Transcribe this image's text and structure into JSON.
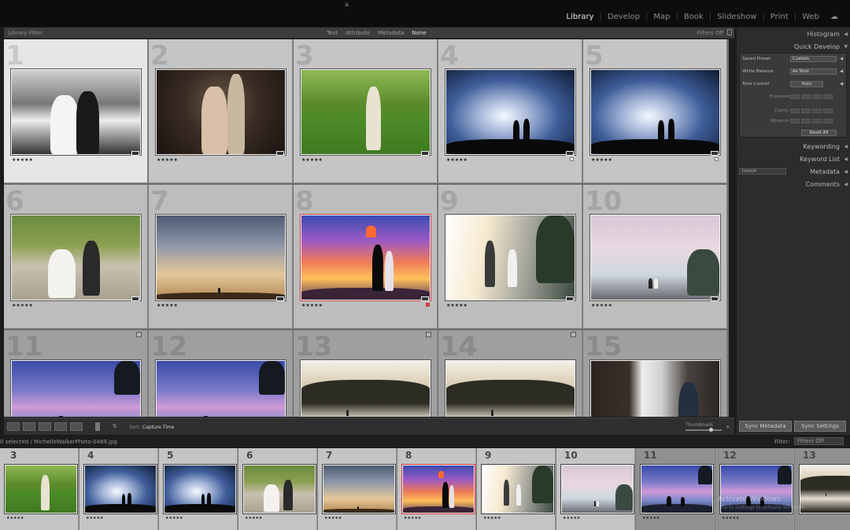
{
  "modules": [
    "Library",
    "Develop",
    "Map",
    "Book",
    "Slideshow",
    "Print",
    "Web"
  ],
  "active_module": "Library",
  "filter_bar": {
    "title": "Library Filter",
    "tabs": [
      "Text",
      "Attribute",
      "Metadata",
      "None"
    ],
    "active_tab": "None",
    "filters_status": "Filters Off"
  },
  "grid": {
    "cells": [
      {
        "num": "1",
        "img": "bride-car",
        "stars": "★★★★★",
        "selected": true
      },
      {
        "num": "2",
        "img": "couple-flowers",
        "stars": "★★★★★"
      },
      {
        "num": "3",
        "img": "bride-garden",
        "stars": "★★★★★"
      },
      {
        "num": "4",
        "img": "veil-clouds",
        "stars": "★★★★★"
      },
      {
        "num": "5",
        "img": "veil-clouds",
        "stars": "★★★★★"
      },
      {
        "num": "6",
        "img": "couple-bench",
        "stars": "★★★★★"
      },
      {
        "num": "7",
        "img": "sunset-sky",
        "stars": "★★★★★"
      },
      {
        "num": "8",
        "img": "lantern",
        "stars": "★★★★★"
      },
      {
        "num": "9",
        "img": "beach-sun",
        "stars": "★★★★★"
      },
      {
        "num": "10",
        "img": "beach-rocks",
        "stars": "★★★★★"
      },
      {
        "num": "11",
        "img": "dusk-silhouette",
        "stars": ""
      },
      {
        "num": "12",
        "img": "dusk-silhouette",
        "stars": ""
      },
      {
        "num": "13",
        "img": "lake-mountains",
        "stars": ""
      },
      {
        "num": "14",
        "img": "lake-mountains",
        "stars": ""
      },
      {
        "num": "15",
        "img": "groom-door",
        "stars": ""
      }
    ]
  },
  "toolbar": {
    "sort_label": "Sort:",
    "sort_value": "Capture Time",
    "thumbnails_label": "Thumbnails"
  },
  "right_panel": {
    "histogram": "Histogram",
    "quick_develop": "Quick Develop",
    "saved_preset_label": "Saved Preset",
    "saved_preset_value": "Custom",
    "white_balance_label": "White Balance",
    "white_balance_value": "As Shot",
    "tone_control_label": "Tone Control",
    "tone_control_value": "Auto",
    "exposure_label": "Exposure",
    "clarity_label": "Clarity",
    "vibrance_label": "Vibrance",
    "reset_all": "Reset All",
    "keywording": "Keywording",
    "keyword_list": "Keyword List",
    "metadata": "Metadata",
    "metadata_preset": "Default",
    "comments": "Comments",
    "sync_metadata": "Sync Metadata",
    "sync_settings": "Sync Settings"
  },
  "filmstrip_header": {
    "status": "0 selected / MichelleWalkerPhoto-0489.jpg",
    "filter_label": "Filter:",
    "filter_value": "Filters Off"
  },
  "filmstrip": [
    {
      "num": "",
      "img": "bride-garden",
      "stars": "★★★★★"
    },
    {
      "num": "4",
      "img": "veil-clouds",
      "stars": "★★★★★"
    },
    {
      "num": "5",
      "img": "veil-clouds",
      "stars": "★★★★★"
    },
    {
      "num": "6",
      "img": "couple-bench",
      "stars": "★★★★★"
    },
    {
      "num": "7",
      "img": "sunset-sky",
      "stars": "★★★★★"
    },
    {
      "num": "8",
      "img": "lantern",
      "stars": "★★★★★",
      "selected": true
    },
    {
      "num": "9",
      "img": "beach-sun",
      "stars": "★★★★★"
    },
    {
      "num": "10",
      "img": "beach-rocks",
      "stars": "★★★★★"
    },
    {
      "num": "11",
      "img": "dusk-silhouette",
      "stars": "★★★★★"
    },
    {
      "num": "12",
      "img": "dusk-silhouette",
      "stars": "★★★★★"
    },
    {
      "num": "13",
      "img": "lake-mountains",
      "stars": ""
    }
  ],
  "filmstrip_first_label": "3",
  "watermark": "Activate Windows",
  "watermark_sub": "Go to Settings to activate Windows."
}
